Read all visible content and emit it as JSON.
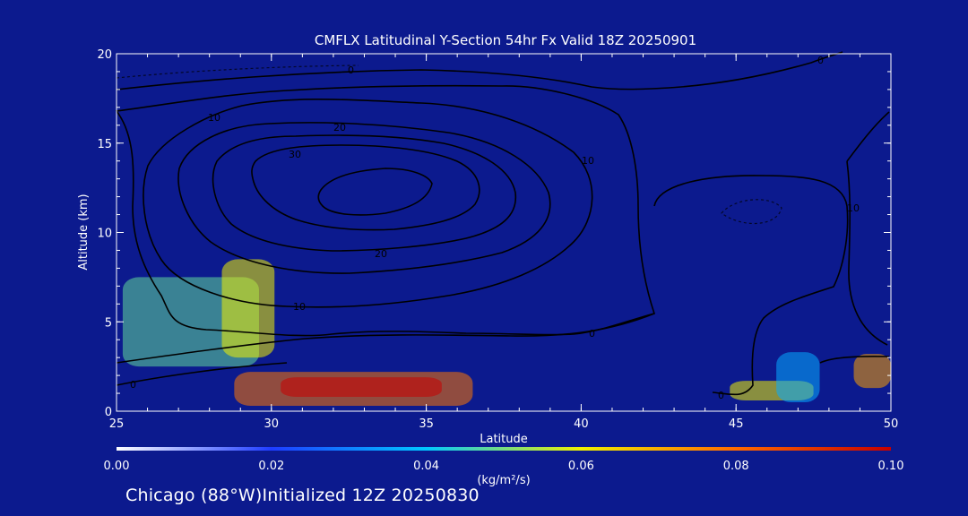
{
  "chart_data": {
    "type": "heatmap",
    "title": "CMFLX Latitudinal Y-Section 54hr  Fx Valid 18Z 20250901",
    "xlabel": "Latitude",
    "ylabel": "Altitude (km)",
    "xlim": [
      25,
      50
    ],
    "ylim": [
      0,
      20
    ],
    "x_ticks": [
      "25",
      "30",
      "35",
      "40",
      "45",
      "50"
    ],
    "y_ticks": [
      "0",
      "5",
      "10",
      "15",
      "20"
    ],
    "grid": false,
    "background_color": "#0c1a8e",
    "filled_field": {
      "name": "CMFLX",
      "units": "(kg/m²/s)",
      "colorbar_min": 0.0,
      "colorbar_max": 0.1,
      "colorbar_ticks": [
        "0.00",
        "0.02",
        "0.04",
        "0.06",
        "0.08",
        "0.10"
      ],
      "colormap": [
        "#0c1a8e",
        "#1e3cff",
        "#00c8ff",
        "#f0f000",
        "#ff6a00",
        "#c80000"
      ],
      "regions": [
        {
          "lat": [
            25.2,
            29.6
          ],
          "alt": [
            2.5,
            7.5
          ],
          "value": 0.008
        },
        {
          "lat": [
            28.4,
            30.1
          ],
          "alt": [
            3.0,
            8.5
          ],
          "value": 0.01
        },
        {
          "lat": [
            28.8,
            36.5
          ],
          "alt": [
            0.3,
            2.2
          ],
          "value": 0.013
        },
        {
          "lat": [
            30.3,
            35.5
          ],
          "alt": [
            0.8,
            1.9
          ],
          "value": 0.018
        },
        {
          "lat": [
            44.8,
            47.5
          ],
          "alt": [
            0.6,
            1.7
          ],
          "value": 0.01
        },
        {
          "lat": [
            46.3,
            47.7
          ],
          "alt": [
            0.5,
            3.3
          ],
          "value": 0.006
        },
        {
          "lat": [
            48.8,
            50.0
          ],
          "alt": [
            1.3,
            3.2
          ],
          "value": 0.012
        }
      ]
    },
    "contour_labels": [
      "0",
      "10",
      "20",
      "30",
      "10",
      "20",
      "10",
      "0",
      "0",
      "10",
      "0",
      "0"
    ]
  },
  "footer": "Chicago (88°W)Initialized 12Z 20250830"
}
